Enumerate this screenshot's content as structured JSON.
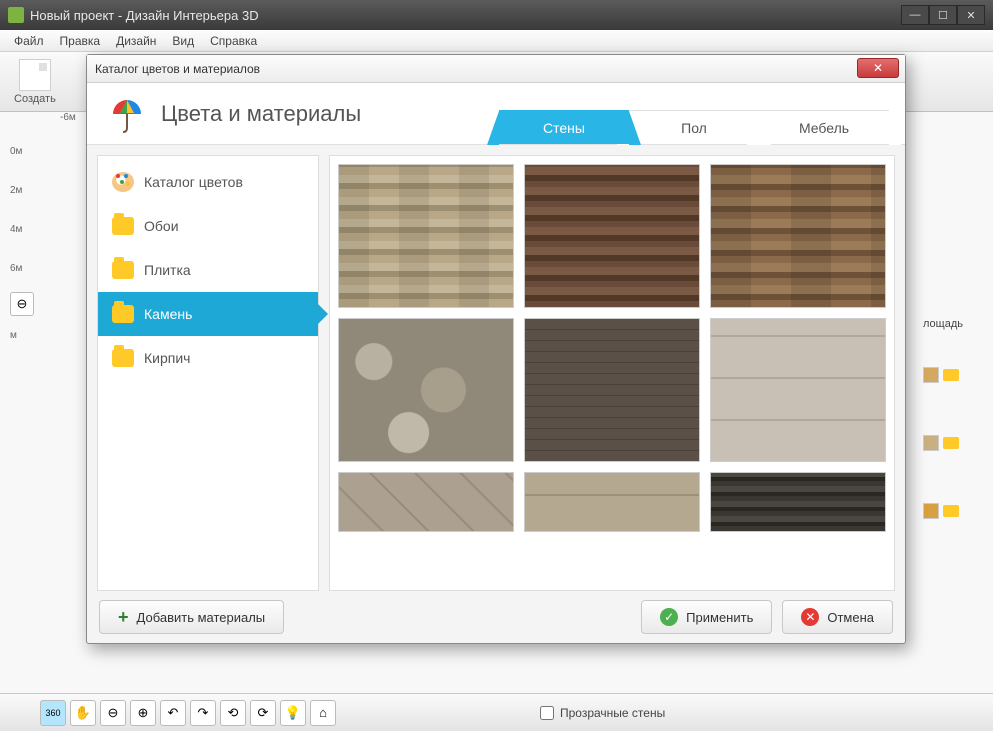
{
  "window": {
    "title": "Новый проект - Дизайн Интерьера 3D"
  },
  "menubar": [
    "Файл",
    "Правка",
    "Дизайн",
    "Вид",
    "Справка"
  ],
  "toolbar": {
    "create_label": "Создать"
  },
  "ruler": {
    "top_label": "-6м",
    "ticks": [
      "0м",
      "2м",
      "4м",
      "6м",
      "м"
    ]
  },
  "right_panel": {
    "area_label": "лощадь"
  },
  "bottom_bar": {
    "tool_360": "360",
    "transparent_walls_label": "Прозрачные стены"
  },
  "dialog": {
    "titlebar": "Каталог цветов и материалов",
    "heading": "Цвета и материалы",
    "tabs": {
      "walls": "Стены",
      "floor": "Пол",
      "furniture": "Мебель"
    },
    "sidebar": {
      "catalog": "Каталог цветов",
      "wallpaper": "Обои",
      "tile": "Плитка",
      "stone": "Камень",
      "brick": "Кирпич"
    },
    "buttons": {
      "add_materials": "Добавить материалы",
      "apply": "Применить",
      "cancel": "Отмена"
    }
  }
}
